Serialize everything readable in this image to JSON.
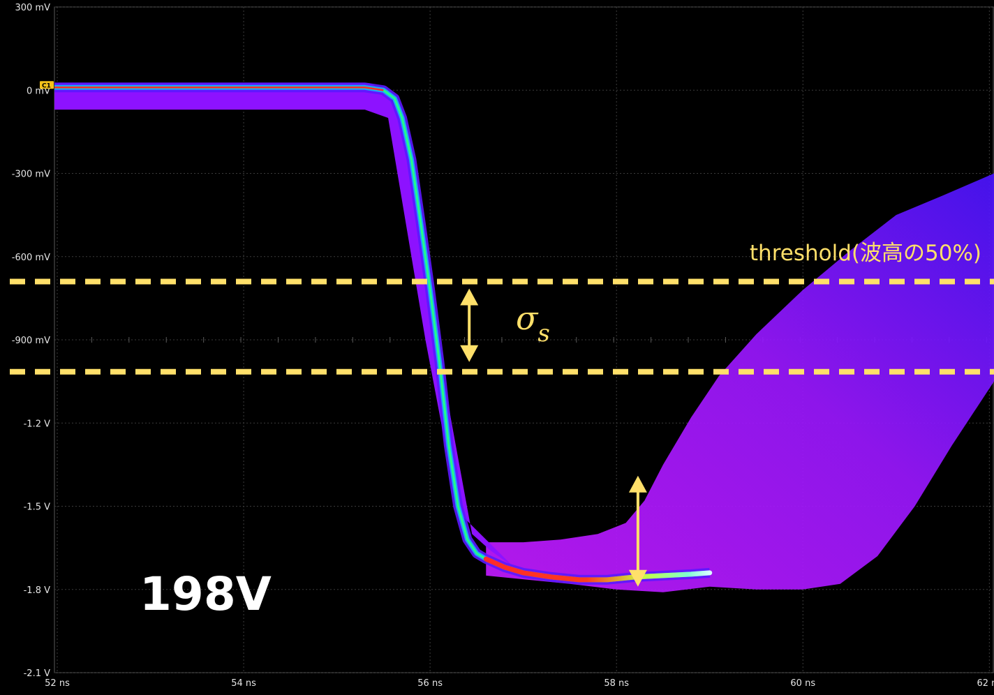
{
  "chart_data": {
    "type": "line",
    "title": "",
    "xlabel": "",
    "ylabel": "",
    "x_unit": "ns",
    "y_unit": "V",
    "xlim": [
      51.97,
      62.05
    ],
    "ylim": [
      -2.1,
      0.3
    ],
    "x_ticks": [
      {
        "value": 52,
        "label": "52 ns"
      },
      {
        "value": 54,
        "label": "54 ns"
      },
      {
        "value": 56,
        "label": "56 ns"
      },
      {
        "value": 58,
        "label": "58 ns"
      },
      {
        "value": 60,
        "label": "60 ns"
      },
      {
        "value": 62,
        "label": "62 ns"
      }
    ],
    "y_ticks": [
      {
        "value": 0.3,
        "label": "300 mV"
      },
      {
        "value": 0.0,
        "label": "0 mV"
      },
      {
        "value": -0.3,
        "label": "-300 mV"
      },
      {
        "value": -0.6,
        "label": "-600 mV"
      },
      {
        "value": -0.9,
        "label": "-900 mV"
      },
      {
        "value": -1.2,
        "label": "-1.2 V"
      },
      {
        "value": -1.5,
        "label": "-1.5 V"
      },
      {
        "value": -1.8,
        "label": "-1.8 V"
      },
      {
        "value": -2.1,
        "label": "-2.1 V"
      }
    ],
    "grid": true,
    "persistence_display": true,
    "series": [
      {
        "name": "C1",
        "color": "#ffd84a",
        "x": [
          51.97,
          53.0,
          54.5,
          55.3,
          55.5,
          55.62,
          55.7,
          55.8,
          55.9,
          56.0,
          56.1,
          56.2,
          56.3,
          56.4,
          56.5,
          56.6,
          56.8,
          57.0,
          57.3,
          57.6,
          57.9,
          58.2,
          58.5,
          58.8,
          59.0
        ],
        "y": [
          0.01,
          0.01,
          0.01,
          0.01,
          0.0,
          -0.03,
          -0.1,
          -0.25,
          -0.48,
          -0.72,
          -0.98,
          -1.28,
          -1.5,
          -1.62,
          -1.67,
          -1.69,
          -1.72,
          -1.74,
          -1.755,
          -1.765,
          -1.765,
          -1.755,
          -1.75,
          -1.745,
          -1.74
        ]
      }
    ],
    "cloud_upper": {
      "x": [
        56.6,
        57.0,
        57.4,
        57.8,
        58.1,
        58.3,
        58.5,
        58.8,
        59.1,
        59.5,
        60.0,
        60.5,
        61.0,
        61.5,
        62.05
      ],
      "y": [
        -1.63,
        -1.63,
        -1.62,
        -1.6,
        -1.56,
        -1.48,
        -1.35,
        -1.18,
        -1.03,
        -0.88,
        -0.72,
        -0.58,
        -0.45,
        -0.38,
        -0.3
      ]
    },
    "cloud_lower": {
      "x": [
        56.6,
        57.5,
        58.0,
        58.5,
        59.0,
        59.5,
        60.0,
        60.4,
        60.8,
        61.2,
        61.6,
        62.05
      ],
      "y": [
        -1.75,
        -1.78,
        -1.8,
        -1.81,
        -1.79,
        -1.8,
        -1.8,
        -1.78,
        -1.68,
        -1.5,
        -1.28,
        -1.05
      ]
    },
    "baseline_lower": -0.07,
    "annotations": {
      "threshold_label": "threshold(波高の50%)",
      "threshold_upper_y": -0.69,
      "threshold_lower_y": -1.015,
      "sigma_symbol": "σ",
      "sigma_subscript": "s",
      "sigma_arrow": {
        "x": 56.42,
        "y_top": -0.715,
        "y_bottom": -0.98
      },
      "amplitude_arrow": {
        "x": 58.23,
        "y_top": -1.39,
        "y_bottom": -1.79
      },
      "voltage_label": "198V",
      "channel_marker": "C1",
      "line_color": "#ffe06a"
    }
  }
}
